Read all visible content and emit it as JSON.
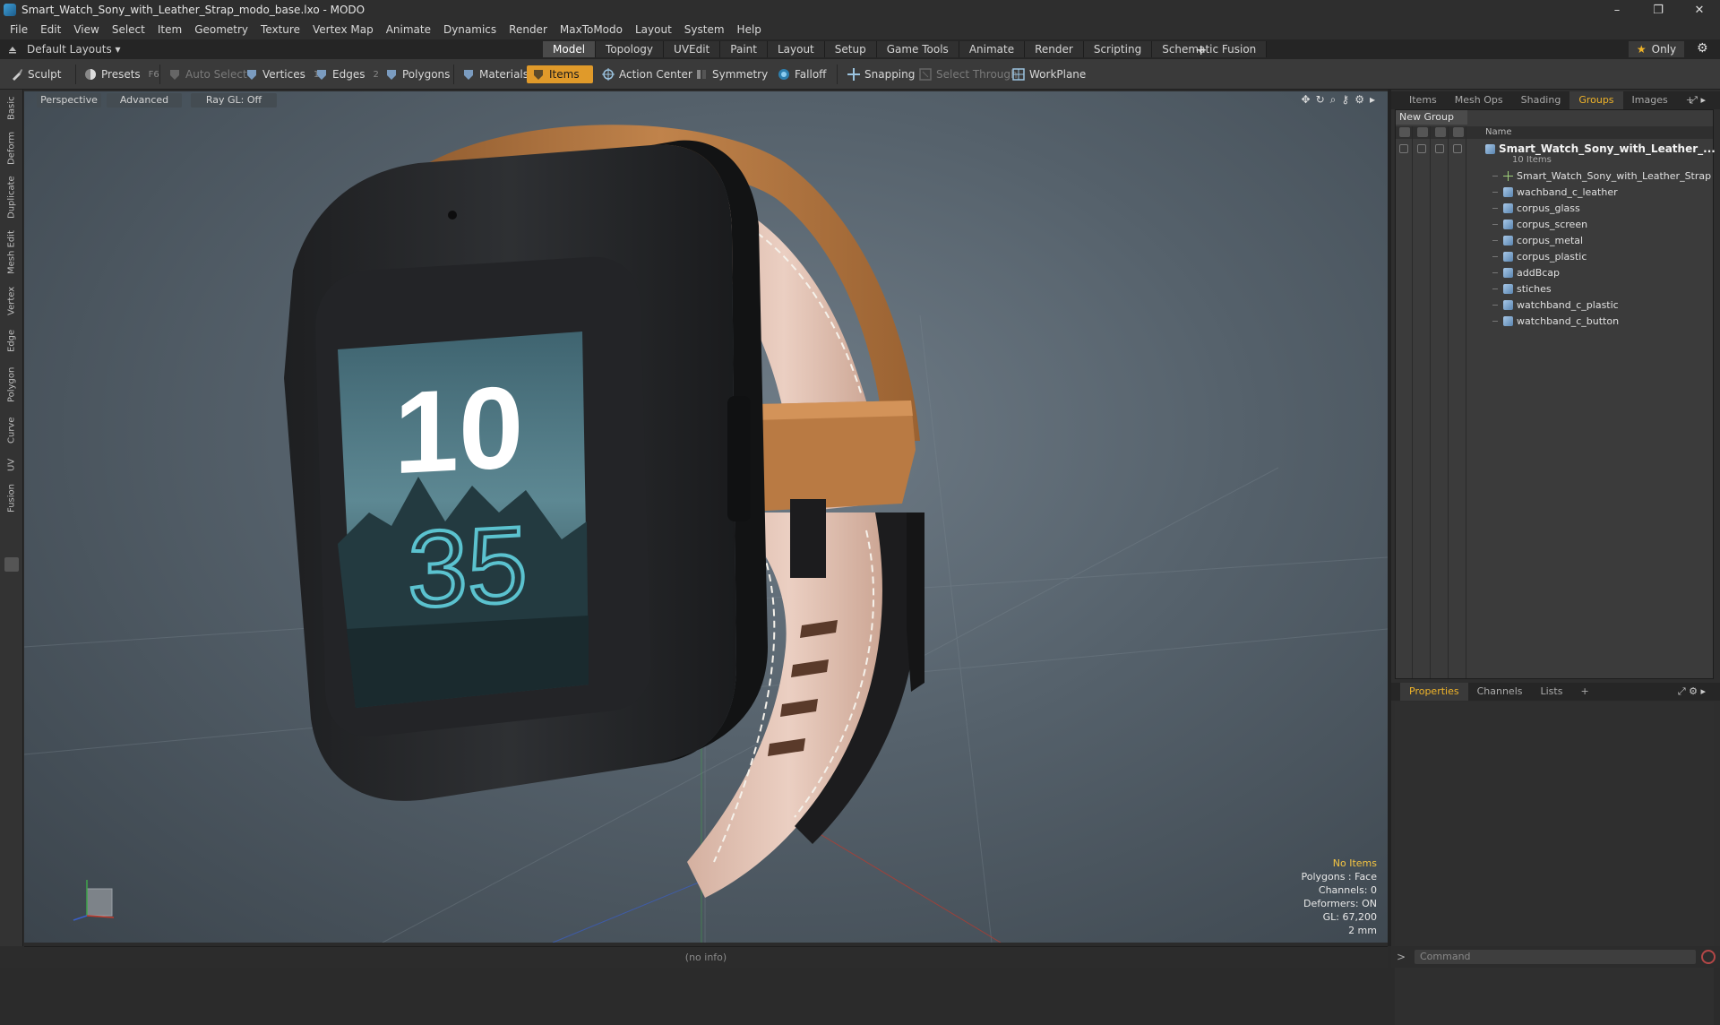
{
  "window": {
    "title": "Smart_Watch_Sony_with_Leather_Strap_modo_base.lxo - MODO",
    "controls": [
      "–",
      "❐",
      "✕"
    ]
  },
  "menu": [
    "File",
    "Edit",
    "View",
    "Select",
    "Item",
    "Geometry",
    "Texture",
    "Vertex Map",
    "Animate",
    "Dynamics",
    "Render",
    "MaxToModo",
    "Layout",
    "System",
    "Help"
  ],
  "layout_selector": "Default Layouts ▾",
  "tabs": [
    "Model",
    "Topology",
    "UVEdit",
    "Paint",
    "Layout",
    "Setup",
    "Game Tools",
    "Animate",
    "Render",
    "Scripting",
    "Schematic Fusion"
  ],
  "active_tab": "Model",
  "tab_plus": "+",
  "only_label": "Only",
  "toolbar": {
    "sculpt": "Sculpt",
    "presets": "Presets",
    "presets_key": "F6",
    "auto_select": "Auto Select",
    "vertices": "Vertices",
    "vertices_key": "1",
    "edges": "Edges",
    "edges_key": "2",
    "polygons": "Polygons",
    "materials": "Materials",
    "items": "Items",
    "action_center": "Action Center",
    "symmetry": "Symmetry",
    "falloff": "Falloff",
    "snapping": "Snapping",
    "select_through": "Select Through",
    "workplane": "WorkPlane"
  },
  "left_tabs": [
    "Basic",
    "Deform",
    "Duplicate",
    "Mesh Edit",
    "Vertex",
    "Edge",
    "Polygon",
    "Curve",
    "UV",
    "Fusion"
  ],
  "viewport": {
    "perspective": "Perspective",
    "advanced": "Advanced",
    "raygl": "Ray GL: Off",
    "watch_hour": "10",
    "watch_minute": "35",
    "stats": {
      "no_items": "No Items",
      "polygons": "Polygons : Face",
      "channels": "Channels: 0",
      "deformers": "Deformers: ON",
      "gl": "GL: 67,200",
      "unit": "2 mm"
    }
  },
  "status_text": "(no info)",
  "right_panel": {
    "top_tabs": [
      "Items",
      "Mesh Ops",
      "Shading",
      "Groups",
      "Images",
      "+"
    ],
    "active_top_tab": "Groups",
    "new_group": "New Group",
    "column_name": "Name",
    "group": {
      "name": "Smart_Watch_Sony_with_Leather_...",
      "count": "10 Items",
      "items": [
        "Smart_Watch_Sony_with_Leather_Strap",
        "wachband_c_leather",
        "corpus_glass",
        "corpus_screen",
        "corpus_metal",
        "corpus_plastic",
        "addBcap",
        "stiches",
        "watchband_c_plastic",
        "watchband_c_button"
      ]
    },
    "bottom_tabs": [
      "Properties",
      "Channels",
      "Lists",
      "+"
    ],
    "active_bottom_tab": "Properties",
    "command_placeholder": "Command"
  },
  "colors": {
    "accent": "#e09a2a",
    "selected_tab_text": "#f0b429",
    "strap_outer": "#b8773f",
    "strap_inner": "#e3c2b4",
    "case": "#2b2c2e",
    "screen_digits_hour": "#ffffff",
    "screen_digits_minute": "#5bc2cf"
  }
}
